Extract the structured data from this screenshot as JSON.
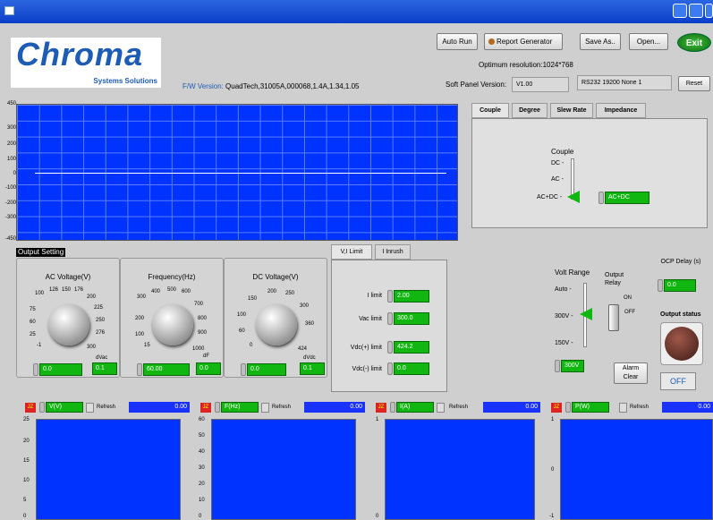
{
  "header": {
    "logo_text": "Chroma",
    "logo_sub": "Systems Solutions",
    "fw_label": "F/W Version",
    "fw_value": "QuadTech,31005A,000068,1.4A,1.34,1.05",
    "auto_run": "Auto Run",
    "report_generator": "Report Generator",
    "save_as": "Save As..",
    "open": "Open...",
    "exit": "Exit",
    "resolution": "Optimum resolution:1024*768",
    "soft_panel_label": "Soft Panel Version:",
    "soft_panel_value": "V1.00",
    "comm": "RS232 19200 None 1",
    "reset": "Reset"
  },
  "main_graph": {
    "y_ticks": [
      "450",
      "300",
      "200",
      "100",
      "0",
      "-100",
      "-200",
      "-300",
      "-450"
    ]
  },
  "couple_tabs": [
    "Couple",
    "Degree",
    "Slew Rate",
    "Impedance"
  ],
  "couple": {
    "title": "Couple",
    "opt_dc": "DC -",
    "opt_ac": "AC -",
    "opt_acdc": "AC+DC -",
    "value": "AC+DC"
  },
  "output_setting": {
    "label": "Output Setting",
    "ac": {
      "title": "AC Voltage(V)",
      "value": "0.0",
      "step": "0.1",
      "unit": "dVac",
      "ticks": [
        "100",
        "126",
        "150",
        "176",
        "200",
        "225",
        "250",
        "276",
        "300",
        "-1",
        "25",
        "60",
        "75"
      ]
    },
    "freq": {
      "title": "Frequency(Hz)",
      "value": "60.00",
      "step": "0.0",
      "unit": "dF",
      "ticks": [
        "300",
        "400",
        "500",
        "600",
        "700",
        "800",
        "900",
        "1000",
        "15",
        "100",
        "200"
      ]
    },
    "dc": {
      "title": "DC Voltage(V)",
      "value": "0.0",
      "step": "0.1",
      "unit": "dVdc",
      "ticks": [
        "150",
        "200",
        "250",
        "300",
        "360",
        "424",
        "0",
        "60",
        "100"
      ]
    }
  },
  "limits": {
    "tabs": [
      "V,I Limit",
      "I Inrush"
    ],
    "ilimit_label": "I limit",
    "ilimit": "2.00",
    "vac_label": "Vac limit",
    "vac": "300.0",
    "vdcp_label": "Vdc(+) limit",
    "vdcp": "424.2",
    "vdcm_label": "Vdc(-) limit",
    "vdcm": "0.0"
  },
  "right": {
    "volt_range": "Volt Range",
    "auto": "Auto -",
    "v300": "300V -",
    "v150": "150V -",
    "range_value": "300V",
    "output_relay": "Output Relay",
    "on": "ON",
    "off": "OFF",
    "ocp": "OCP Delay (s)",
    "ocp_value": "0.0",
    "alarm": "Alarm Clear",
    "output_status": "Output status",
    "status": "OFF"
  },
  "meters": [
    {
      "icon": "JZ",
      "name": "V(V)",
      "refresh": "Refresh",
      "value": "0.00",
      "y": [
        "25",
        "20",
        "15",
        "10",
        "5",
        "0"
      ]
    },
    {
      "icon": "JZ",
      "name": "F(Hz)",
      "refresh": "Refresh",
      "value": "0.00",
      "y": [
        "60",
        "50",
        "40",
        "30",
        "20",
        "10",
        "0"
      ]
    },
    {
      "icon": "JZ",
      "name": "I(A)",
      "refresh": "Refresh",
      "value": "0.00",
      "y": [
        "1",
        "0"
      ]
    },
    {
      "icon": "JZ",
      "name": "P(W)",
      "refresh": "Refresh",
      "value": "0.00",
      "y": [
        "1",
        "0",
        "-1"
      ]
    }
  ],
  "colors": {
    "accent": "#0033ff",
    "green": "#11b611",
    "exit": "#1a8a1a"
  }
}
